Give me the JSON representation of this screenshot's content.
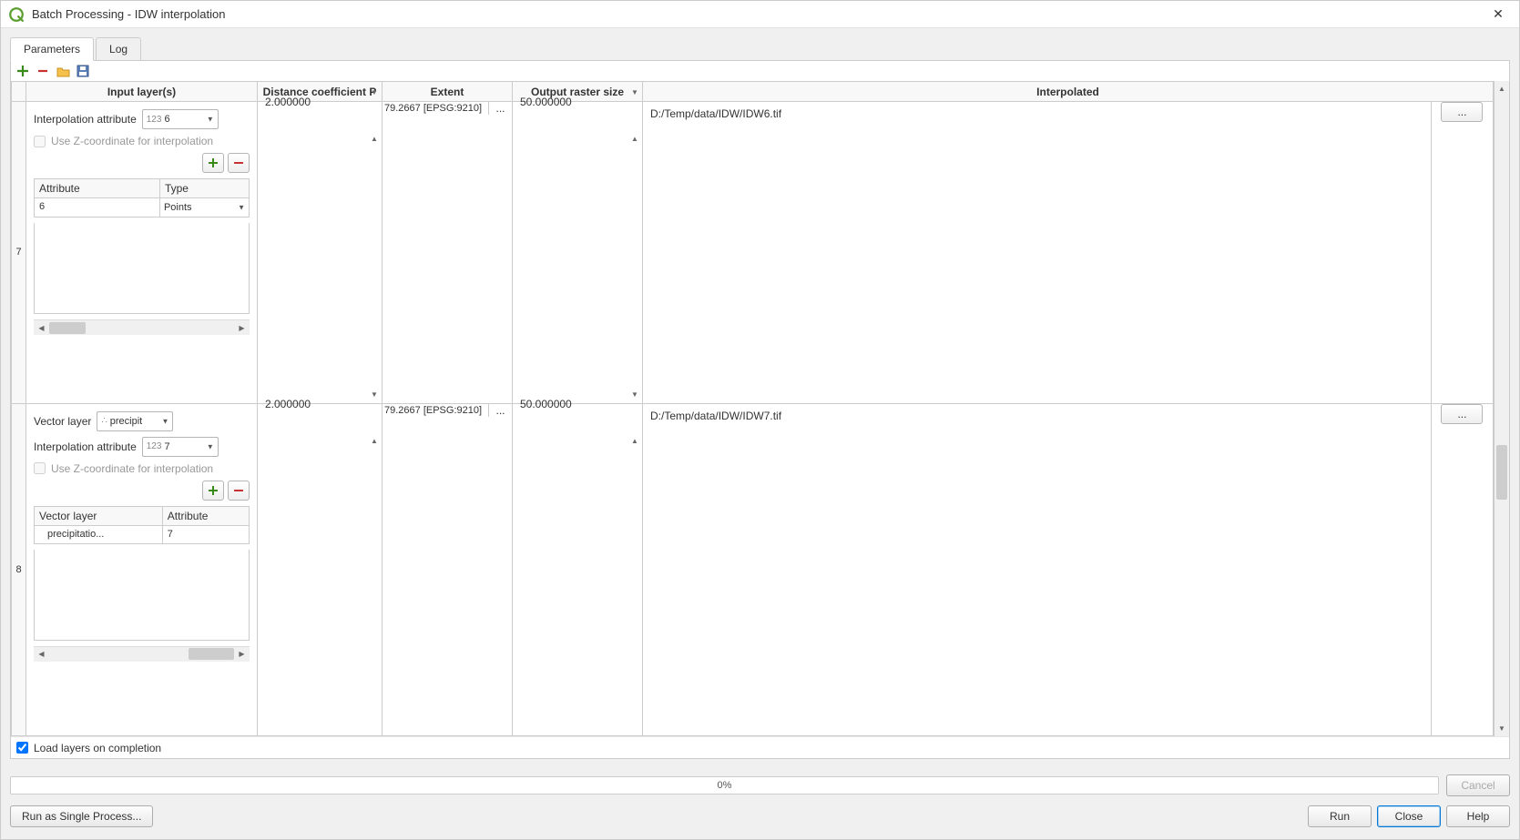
{
  "window": {
    "title": "Batch Processing - IDW interpolation"
  },
  "tabs": {
    "parameters": "Parameters",
    "log": "Log"
  },
  "columns": {
    "input": "Input layer(s)",
    "distance": "Distance coefficient P",
    "extent": "Extent",
    "raster": "Output raster size",
    "interpolated": "Interpolated"
  },
  "labels": {
    "vector_layer": "Vector layer",
    "interp_attr": "Interpolation attribute",
    "use_z": "Use Z-coordinate for interpolation",
    "attribute": "Attribute",
    "type": "Type",
    "vector_layer_col": "Vector layer",
    "attribute_col": "Attribute",
    "points": "Points"
  },
  "rows": [
    {
      "num": "7",
      "interp_attr_prefix": "123",
      "interp_attr": "6",
      "inner_mode": "attr_type",
      "inner_attr": "6",
      "inner_type": "Points",
      "distance": "2.000000",
      "extent": "79.2667 [EPSG:9210]",
      "raster": "50.000000",
      "output": "D:/Temp/data/IDW/IDW6.tif"
    },
    {
      "num": "8",
      "vector_layer_val": "precipit",
      "interp_attr_prefix": "123",
      "interp_attr": "7",
      "inner_mode": "vec_attr",
      "inner_vec": "precipitatio...",
      "inner_attr": "7",
      "distance": "2.000000",
      "extent": "79.2667 [EPSG:9210]",
      "raster": "50.000000",
      "output": "D:/Temp/data/IDW/IDW7.tif"
    }
  ],
  "footer": {
    "load_layers": "Load layers on completion",
    "progress": "0%",
    "cancel": "Cancel",
    "run_single": "Run as Single Process...",
    "run": "Run",
    "close": "Close",
    "help": "Help"
  }
}
